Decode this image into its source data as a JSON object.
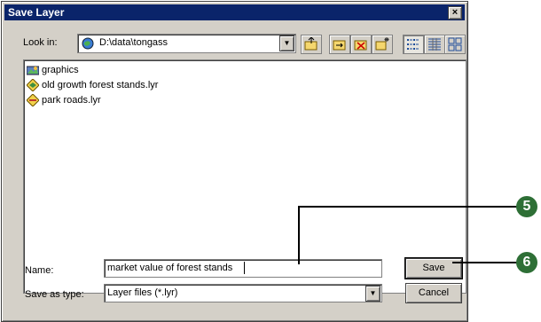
{
  "window": {
    "title": "Save Layer",
    "close_glyph": "×"
  },
  "lookin": {
    "label": "Look in:",
    "value": "D:\\data\\tongass",
    "dropdown_glyph": "▼"
  },
  "toolbar": [
    {
      "name": "up-one-level",
      "icon": "folder-up-icon"
    },
    {
      "name": "connect-folder",
      "icon": "connect-folder-icon"
    },
    {
      "name": "disconnect-folder",
      "icon": "disconnect-folder-icon"
    },
    {
      "name": "new-folder",
      "icon": "new-folder-icon"
    },
    {
      "name": "list-view",
      "icon": "list-view-icon"
    },
    {
      "name": "details-view",
      "icon": "details-view-icon"
    },
    {
      "name": "thumbnails-view",
      "icon": "thumbnails-view-icon"
    }
  ],
  "files": [
    {
      "name": "graphics",
      "icon": "graphics-layer-icon"
    },
    {
      "name": "old growth forest stands.lyr",
      "icon": "layer-file-icon"
    },
    {
      "name": "park roads.lyr",
      "icon": "layer-file-icon"
    }
  ],
  "name_field": {
    "label": "Name:",
    "value": "market value of forest stands"
  },
  "type_field": {
    "label": "Save as type:",
    "value": "Layer files (*.lyr)",
    "dropdown_glyph": "▼"
  },
  "buttons": {
    "save": "Save",
    "cancel": "Cancel"
  },
  "callouts": {
    "five": "5",
    "six": "6"
  }
}
